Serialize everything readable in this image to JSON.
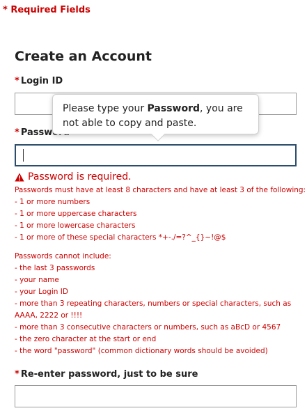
{
  "required_note": "* Required Fields",
  "page_title": "Create an Account",
  "fields": {
    "login_id": {
      "label": "Login ID",
      "value": ""
    },
    "password": {
      "label": "Password",
      "value": ""
    },
    "reenter": {
      "label": "Re-enter password, just to be sure",
      "value": ""
    }
  },
  "required_marker": "*",
  "tooltip": {
    "before": "Please type your ",
    "bold": "Password",
    "after": ", you are not able to copy and paste."
  },
  "error": {
    "icon": "warning-triangle-icon",
    "message": "Password is required."
  },
  "rules_must": [
    "Passwords must have at least 8 characters and have at least 3 of the following:",
    "- 1 or more numbers",
    "- 1 or more uppercase characters",
    "- 1 or more lowercase characters",
    "- 1 or more of these special characters *+-./=?^_{}~!@$"
  ],
  "rules_cannot": [
    "Passwords cannot include:",
    "- the last 3 passwords",
    "- your name",
    "- your Login ID",
    "- more than 3 repeating characters, numbers or special characters, such as",
    "AAAA, 2222 or !!!!",
    "- more than 3 consecutive characters or numbers, such as aBcD or 4567",
    "- the zero character at the start or end",
    "- the word \"password\" (common dictionary words should be avoided)"
  ],
  "colors": {
    "error": "#cc0000",
    "focus_border": "#2b4d6b"
  }
}
